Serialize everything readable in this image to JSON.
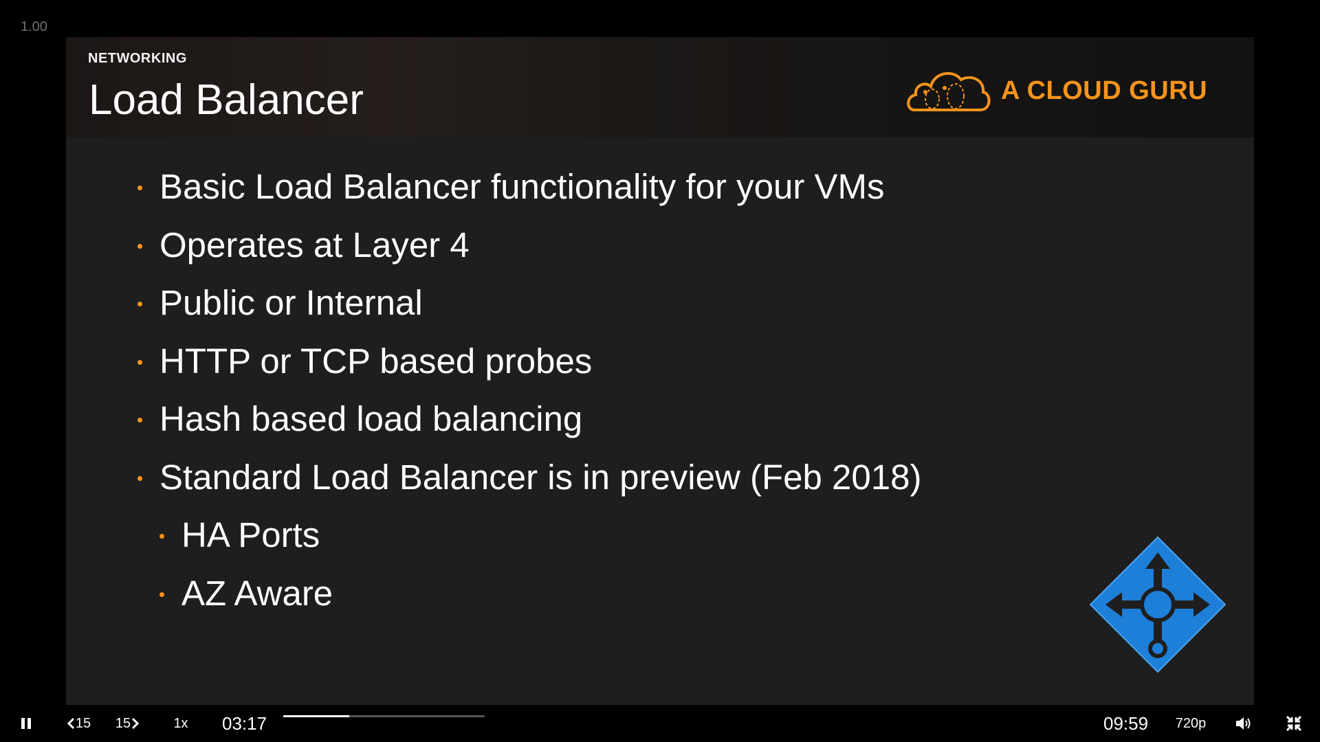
{
  "player": {
    "rate_indicator": "1.00",
    "current_time": "03:17",
    "duration": "09:59",
    "playback_rate": "1x",
    "quality": "720p",
    "rewind_label": "15",
    "forward_label": "15",
    "progress": 0.329
  },
  "slide": {
    "section": "NETWORKING",
    "title": "Load Balancer",
    "brand": "A CLOUD GURU",
    "bullets": [
      "Basic Load Balancer functionality for your VMs",
      "Operates at Layer 4",
      "Public or Internal",
      "HTTP or TCP based probes",
      "Hash based load balancing",
      "Standard Load Balancer is in preview (Feb 2018)"
    ],
    "sub_bullets": [
      "HA Ports",
      "AZ Aware"
    ]
  },
  "colors": {
    "accent": "#f7941d",
    "azure_blue": "#1e7fd8",
    "slide_bg": "#1e1e1e"
  },
  "icons": {
    "pause": "pause-icon",
    "rewind": "rewind-15-icon",
    "forward": "forward-15-icon",
    "volume": "volume-icon",
    "exit_fullscreen": "exit-fullscreen-icon",
    "brand_logo": "cloud-logo-icon",
    "load_balancer": "load-balancer-icon"
  }
}
